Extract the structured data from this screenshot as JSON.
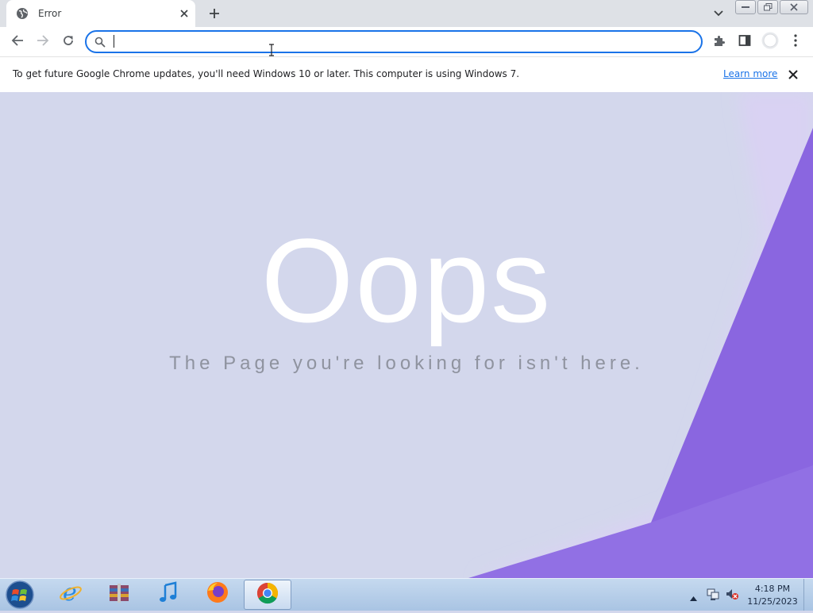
{
  "browser": {
    "tab": {
      "title": "Error",
      "favicon": "globe-icon"
    },
    "new_tab_icon": "plus-icon",
    "tab_search_icon": "chevron-down-icon",
    "window_controls": [
      "minimize-icon",
      "restore-icon",
      "close-icon"
    ],
    "toolbar": {
      "back_icon": "arrow-left-icon",
      "forward_icon": "arrow-right-icon",
      "reload_icon": "reload-icon",
      "address_value": "",
      "address_icon": "search-icon",
      "extensions_icon": "puzzle-icon",
      "side_panel_icon": "side-panel-icon",
      "profile_icon": "avatar-icon",
      "menu_icon": "kebab-menu-icon"
    },
    "accent_color": "#1a73e8"
  },
  "infobar": {
    "message": "To get future Google Chrome updates, you'll need Windows 10 or later. This computer is using Windows 7.",
    "link": "Learn more",
    "close_icon": "close-icon"
  },
  "page": {
    "heading": "Oops",
    "subtitle": "The Page you're looking for isn't here.",
    "background_color": "#d3d7ec",
    "accent_color": "#8a66e0"
  },
  "taskbar": {
    "apps": [
      {
        "name": "Internet Explorer",
        "icon": "internet-explorer-icon",
        "active": false
      },
      {
        "name": "WinRAR",
        "icon": "winrar-icon",
        "active": false
      },
      {
        "name": "iTunes",
        "icon": "itunes-icon",
        "active": false
      },
      {
        "name": "Firefox",
        "icon": "firefox-icon",
        "active": false
      },
      {
        "name": "Google Chrome",
        "icon": "chrome-icon",
        "active": true
      }
    ],
    "tray": {
      "time": "4:18 PM",
      "date": "11/25/2023"
    }
  }
}
